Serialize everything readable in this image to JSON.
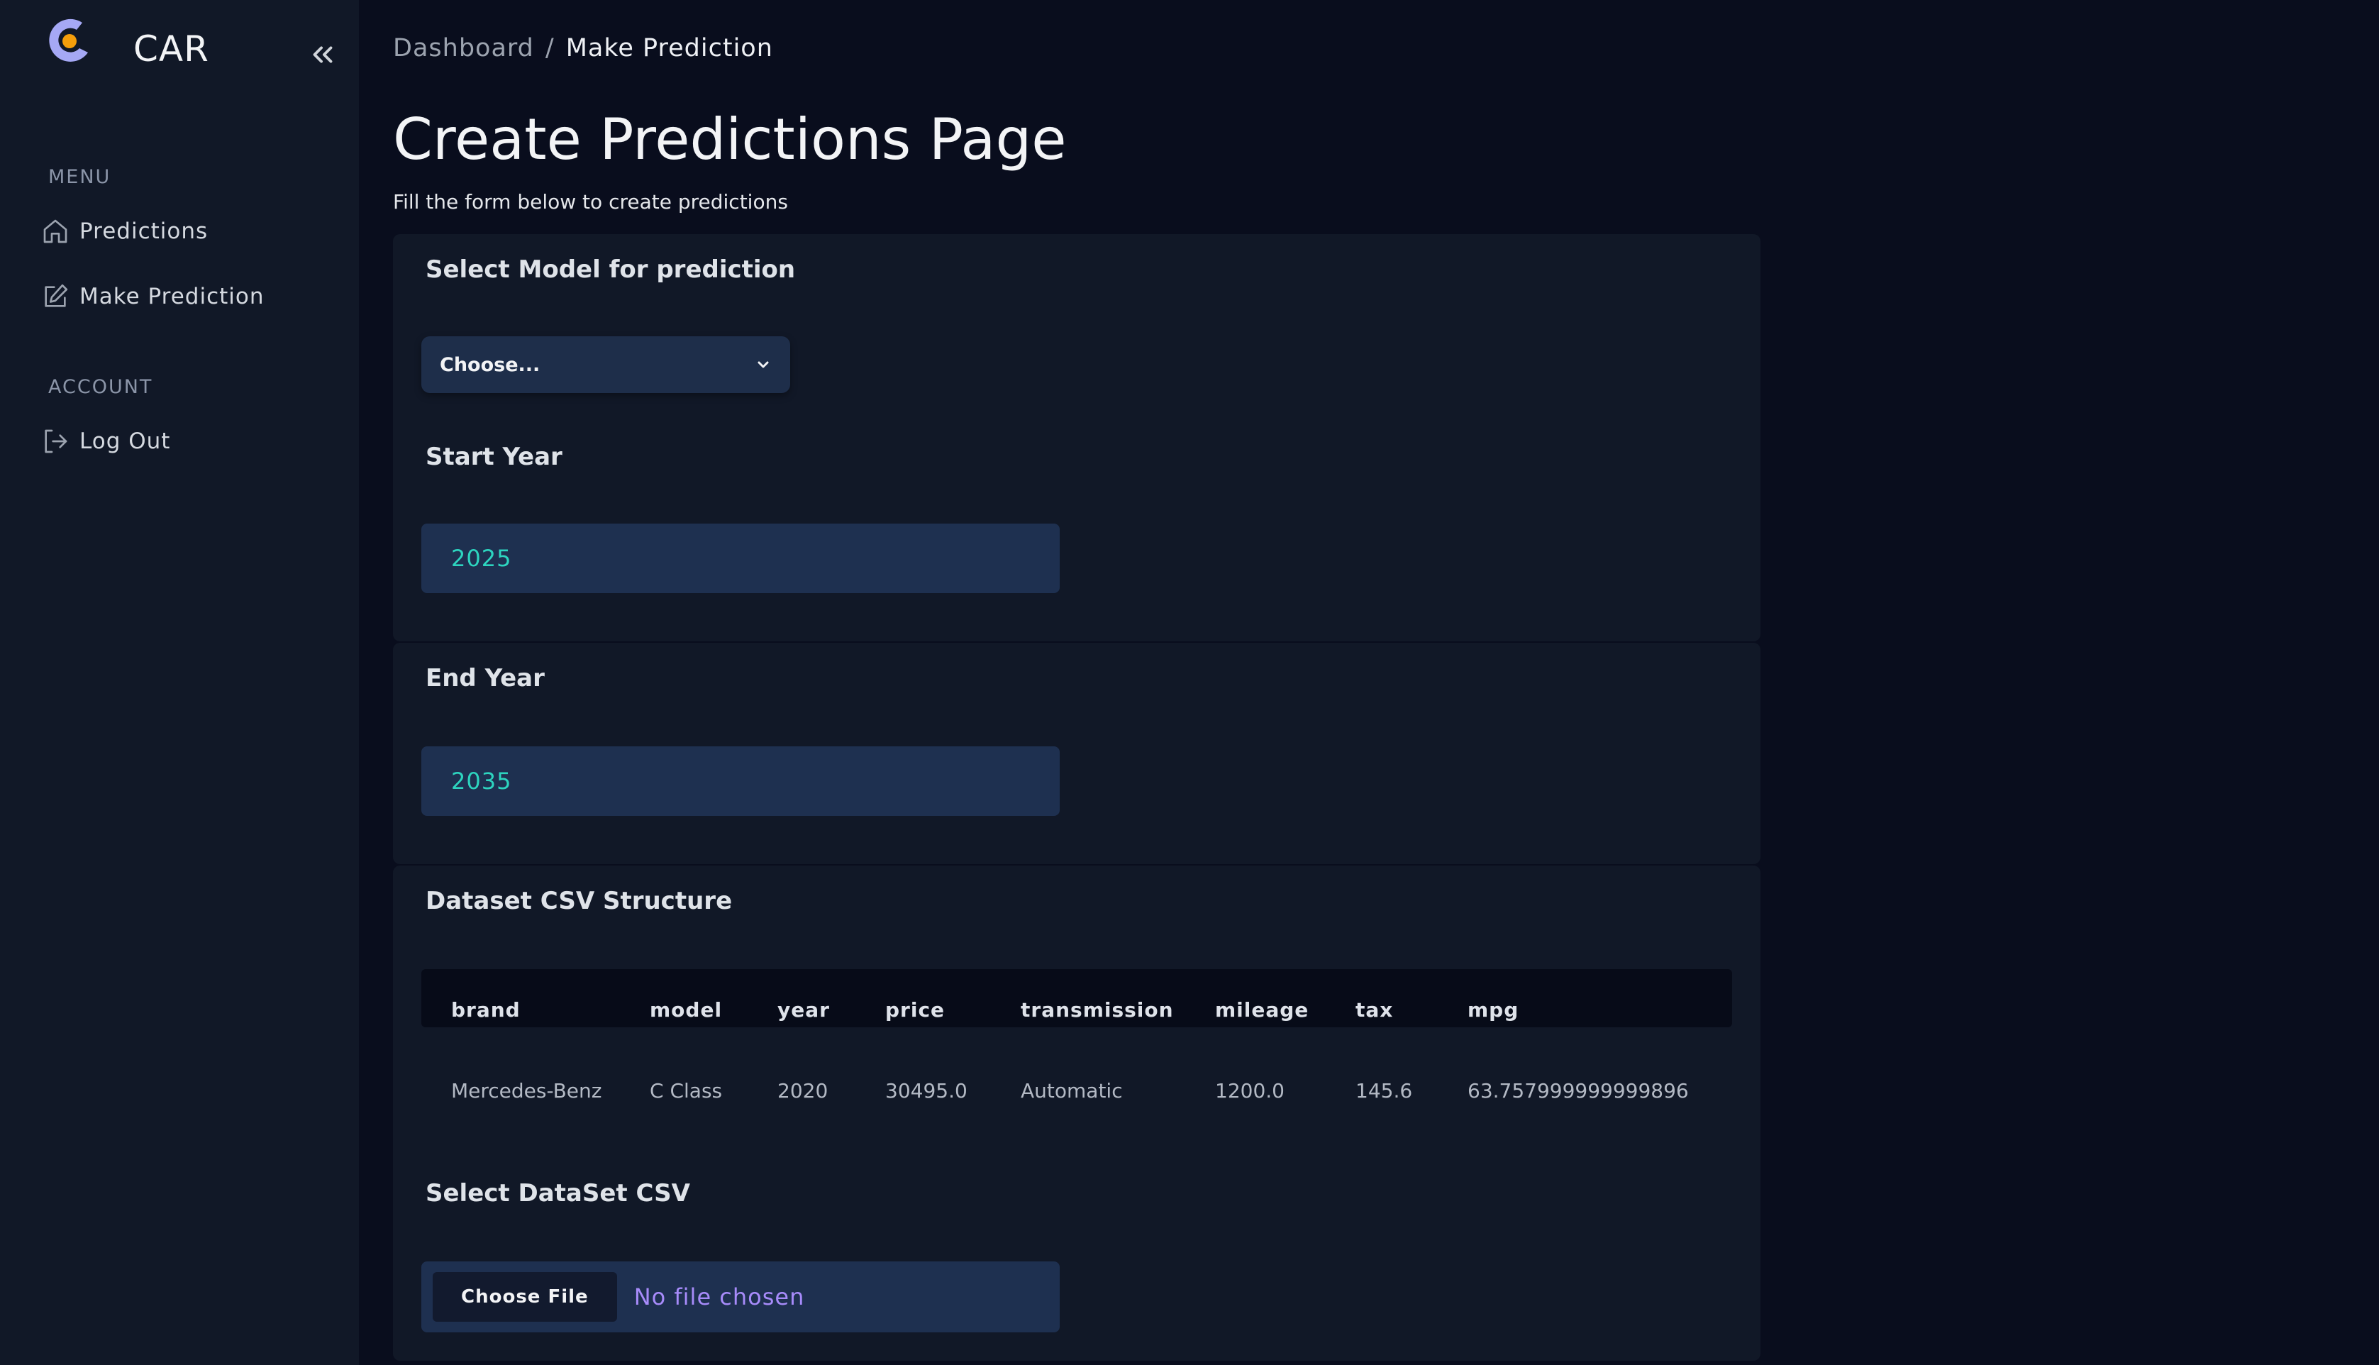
{
  "brand": {
    "name": "CAR",
    "logo_icon": "car-logo-icon",
    "accent": "#f59e0b",
    "logo_color": "#a5a8f5"
  },
  "sidebar": {
    "sections": [
      {
        "heading": "MENU",
        "items": [
          {
            "label": "Predictions",
            "icon": "home-icon"
          },
          {
            "label": "Make Prediction",
            "icon": "edit-icon"
          }
        ]
      },
      {
        "heading": "ACCOUNT",
        "items": [
          {
            "label": "Log Out",
            "icon": "logout-icon"
          }
        ]
      }
    ],
    "collapse_icon": "chevrons-left-icon"
  },
  "breadcrumb": {
    "parent": "Dashboard",
    "separator": "/",
    "current": "Make Prediction"
  },
  "page": {
    "title": "Create Predictions Page",
    "subtitle": "Fill the form below to create predictions"
  },
  "form": {
    "model": {
      "label": "Select Model for prediction",
      "selected": "Choose..."
    },
    "start_year": {
      "label": "Start Year",
      "value": "2025"
    },
    "end_year": {
      "label": "End Year",
      "value": "2035"
    },
    "dataset_structure": {
      "label": "Dataset CSV Structure",
      "columns": [
        "brand",
        "model",
        "year",
        "price",
        "transmission",
        "mileage",
        "tax",
        "mpg"
      ],
      "rows": [
        [
          "Mercedes-Benz",
          "C Class",
          "2020",
          "30495.0",
          "Automatic",
          "1200.0",
          "145.6",
          "63.757999999999896"
        ]
      ]
    },
    "dataset_file": {
      "label": "Select DataSet CSV",
      "button": "Choose File",
      "status": "No file chosen"
    }
  },
  "colors": {
    "background": "#090d1d",
    "sidebar": "#111827",
    "card": "#111827",
    "input": "#1e3050",
    "input_text": "#2dd4bf",
    "file_status": "#a78bfa"
  }
}
